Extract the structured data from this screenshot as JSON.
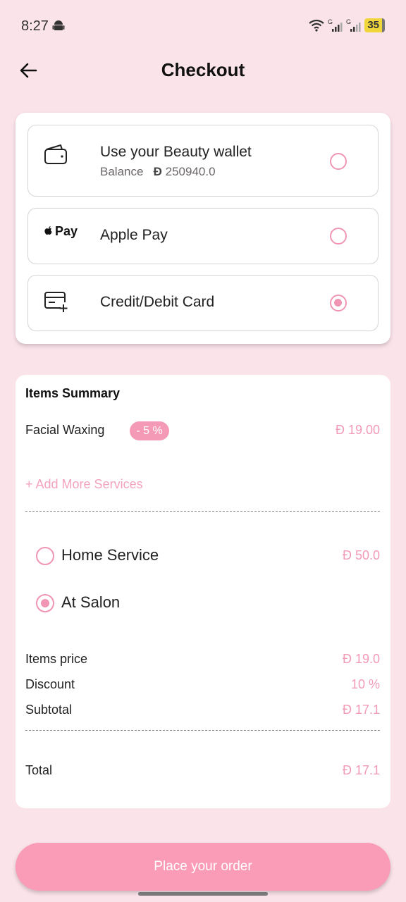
{
  "status_bar": {
    "time": "8:27",
    "battery": "35",
    "network_1": "G",
    "network_2": "G"
  },
  "header": {
    "title": "Checkout"
  },
  "payment": {
    "wallet": {
      "label": "Use your Beauty wallet",
      "balance_label": "Balance",
      "currency": "Đ",
      "balance": "250940.0",
      "selected": false
    },
    "apple_pay": {
      "label": "Apple Pay",
      "logo_text": "Pay",
      "selected": false
    },
    "card": {
      "label": "Credit/Debit Card",
      "selected": true
    }
  },
  "summary": {
    "title": "Items Summary",
    "items": [
      {
        "name": "Facial Waxing",
        "discount": "- 5 %",
        "price": "Đ 19.00"
      }
    ],
    "add_more": "+ Add More Services",
    "services": [
      {
        "label": "Home Service",
        "price": "Đ 50.0",
        "selected": false
      },
      {
        "label": "At Salon",
        "price": "",
        "selected": true
      }
    ],
    "items_price_label": "Items price",
    "items_price": "Đ 19.0",
    "discount_label": "Discount",
    "discount": "10 %",
    "subtotal_label": "Subtotal",
    "subtotal": "Đ 17.1",
    "total_label": "Total",
    "total": "Đ 17.1"
  },
  "actions": {
    "place_order": "Place your order"
  },
  "colors": {
    "background": "#fbe3ea",
    "accent": "#f39ab6",
    "button": "#fa9bb8"
  },
  "icons": [
    "back-arrow-icon",
    "wallet-icon",
    "apple-logo-icon",
    "credit-card-add-icon",
    "wifi-icon",
    "signal-icon",
    "android-icon"
  ]
}
